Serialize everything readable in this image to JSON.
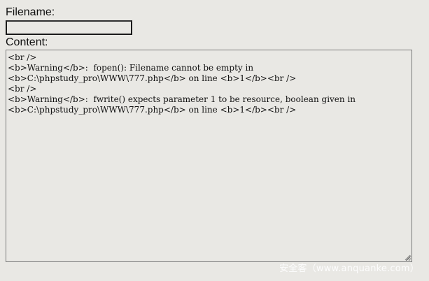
{
  "form": {
    "filename_label": "Filename:",
    "filename_value": "",
    "content_label": "Content:",
    "content_value": "<br />\n<b>Warning</b>:  fopen(): Filename cannot be empty in\n<b>C:\\phpstudy_pro\\WWW\\777.php</b> on line <b>1</b><br />\n<br />\n<b>Warning</b>:  fwrite() expects parameter 1 to be resource, boolean given in\n<b>C:\\phpstudy_pro\\WWW\\777.php</b> on line <b>1</b><br />"
  },
  "watermark": {
    "text": "安全客（www.anquanke.com）"
  },
  "icons": {
    "resize_grip": "resize-grip-icon"
  },
  "colors": {
    "background": "#e9e8e4",
    "text": "#111111",
    "input_border": "#1a1a1a",
    "textarea_border": "#7a7a7a"
  }
}
